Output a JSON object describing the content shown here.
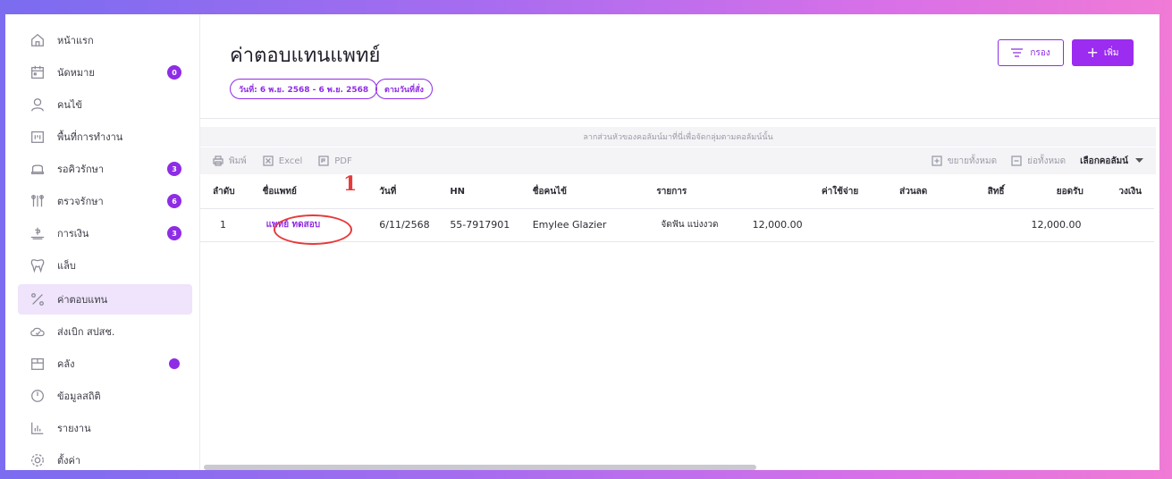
{
  "sidebar": {
    "items": [
      {
        "label": "หน้าแรก",
        "icon": "home-icon"
      },
      {
        "label": "นัดหมาย",
        "icon": "calendar-icon",
        "badge": "0"
      },
      {
        "label": "คนไข้",
        "icon": "user-icon"
      },
      {
        "label": "พื้นที่การทำงาน",
        "icon": "workspace-icon"
      },
      {
        "label": "รอคิวรักษา",
        "icon": "chair-icon",
        "badge": "3"
      },
      {
        "label": "ตรวจรักษา",
        "icon": "tools-icon",
        "badge": "6"
      },
      {
        "label": "การเงิน",
        "icon": "money-icon",
        "badge": "3"
      },
      {
        "label": "แล็บ",
        "icon": "tooth-icon"
      },
      {
        "label": "ค่าตอบแทน",
        "icon": "percent-icon"
      },
      {
        "label": "ส่งเบิก สปสช.",
        "icon": "cloud-icon"
      },
      {
        "label": "คลัง",
        "icon": "box-icon"
      },
      {
        "label": "ข้อมูลสถิติ",
        "icon": "gauge-icon"
      },
      {
        "label": "รายงาน",
        "icon": "chart-icon"
      },
      {
        "label": "ตั้งค่า",
        "icon": "gear-icon"
      }
    ]
  },
  "header": {
    "title": "ค่าตอบแทนแพทย์",
    "date_chip": "วันที่: 6 พ.ย. 2568 - 6 พ.ย. 2568",
    "order_chip": "ตามวันที่สั่ง",
    "filter_label": "กรอง",
    "add_label": "เพิ่ม"
  },
  "grid": {
    "group_hint": "ลากส่วนหัวของคอลัมน์มาที่นี่เพื่อจัดกลุ่มตามคอลัมน์นั้น",
    "toolbar": {
      "print": "พิมพ์",
      "excel": "Excel",
      "pdf": "PDF",
      "expand_all": "ขยายทั้งหมด",
      "collapse_all": "ย่อทั้งหมด",
      "choose_columns": "เลือกคอลัมน์"
    },
    "columns": [
      "ลำดับ",
      "ชื่อแพทย์",
      "วันที่",
      "HN",
      "ชื่อคนไข้",
      "รายการ",
      "ค่าใช้จ่าย",
      "ส่วนลด",
      "สิทธิ์",
      "ยอดรับ",
      "วงเงิน"
    ],
    "rows": [
      {
        "no": "1",
        "doctor": "แพทย์ ทดสอบ",
        "date": "6/11/2568",
        "hn": "55-7917901",
        "patient": "Emylee Glazier",
        "item": "จัดฟัน แบ่งงวด",
        "cost": "12,000.00",
        "discount": "",
        "right": "",
        "received": "12,000.00",
        "limit": ""
      }
    ]
  },
  "annotation": {
    "number": "1",
    "color": "#e53a3a"
  },
  "colors": {
    "accent": "#8e2ce6",
    "active_bg": "#efe4fb"
  }
}
